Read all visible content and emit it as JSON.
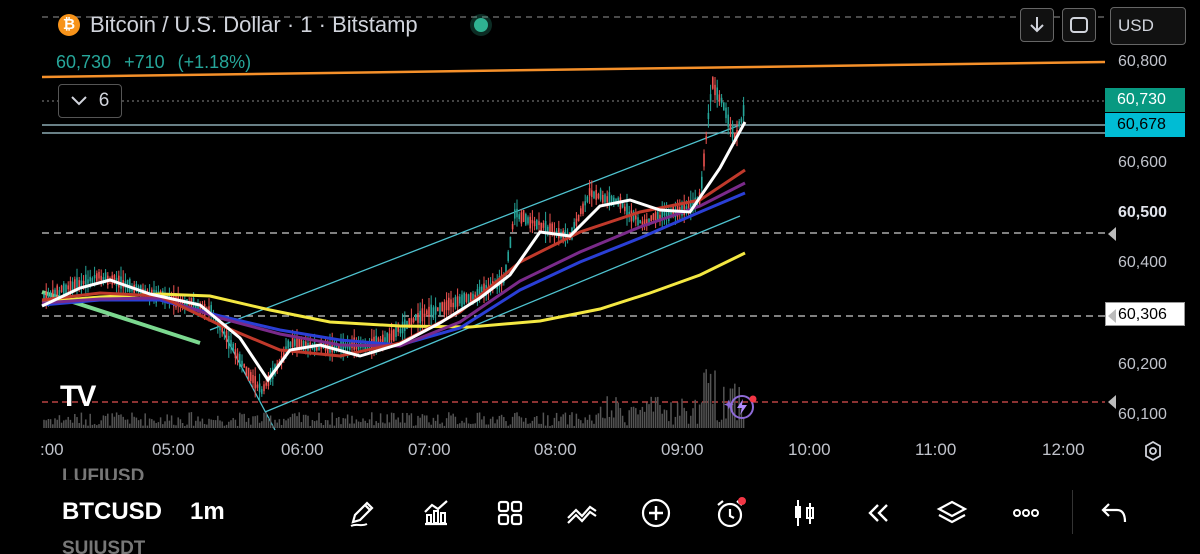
{
  "header": {
    "title": "Bitcoin / U.S. Dollar · 1 · Bitstamp",
    "btc_glyph": "₿",
    "price": "60,730",
    "change": "+710",
    "change_pct": "(+1.18%)",
    "indicators_count": "6",
    "currency": "USD"
  },
  "price_axis": {
    "labels": [
      "60,800",
      "60,600",
      "60,500",
      "60,400",
      "60,200",
      "60,100"
    ],
    "current_price_tag": "60,730",
    "line_tag": "60,678",
    "alert_tag": "60,306"
  },
  "time_axis": {
    "labels": [
      ":00",
      "05:00",
      "06:00",
      "07:00",
      "08:00",
      "09:00",
      "10:00",
      "11:00",
      "12:00"
    ]
  },
  "watermark": "TV",
  "bottom": {
    "symbol_above": "LUFIUSD",
    "symbol": "BTCUSD",
    "symbol_below": "SUIUSDT",
    "interval": "1m",
    "tools": [
      "pencil-icon",
      "indicators-icon",
      "grid-icon",
      "patterns-icon",
      "plus-icon",
      "alarm-icon",
      "candles-icon",
      "replay-icon",
      "layers-icon",
      "more-icon",
      "undo-icon"
    ]
  },
  "colors": {
    "up": "#26a69a",
    "orange": "#f5a623",
    "teal_tag": "#089981",
    "cyan_tag": "#00bcd4"
  }
}
